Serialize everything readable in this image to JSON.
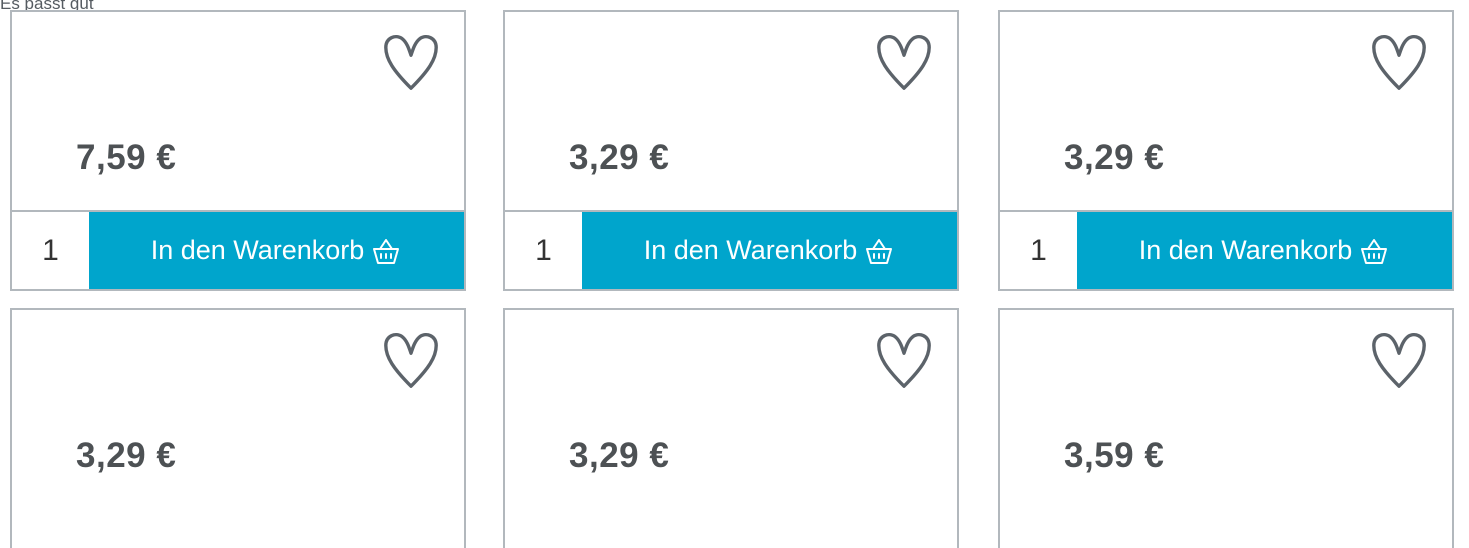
{
  "top_cut_text": "Es passt gut",
  "cart_button_label": "In den Warenkorb",
  "icons": {
    "favorite": "heart-outline-icon",
    "cart": "basket-icon"
  },
  "colors": {
    "accent": "#00a5cc",
    "price_text": "#4d5154",
    "border": "#b2b8bd",
    "icon_stroke": "#5c636a"
  },
  "products": [
    {
      "price": "7,59 €",
      "quantity": "1"
    },
    {
      "price": "3,29 €",
      "quantity": "1"
    },
    {
      "price": "3,29 €",
      "quantity": "1"
    },
    {
      "price": "3,29 €"
    },
    {
      "price": "3,29 €"
    },
    {
      "price": "3,59 €"
    }
  ]
}
